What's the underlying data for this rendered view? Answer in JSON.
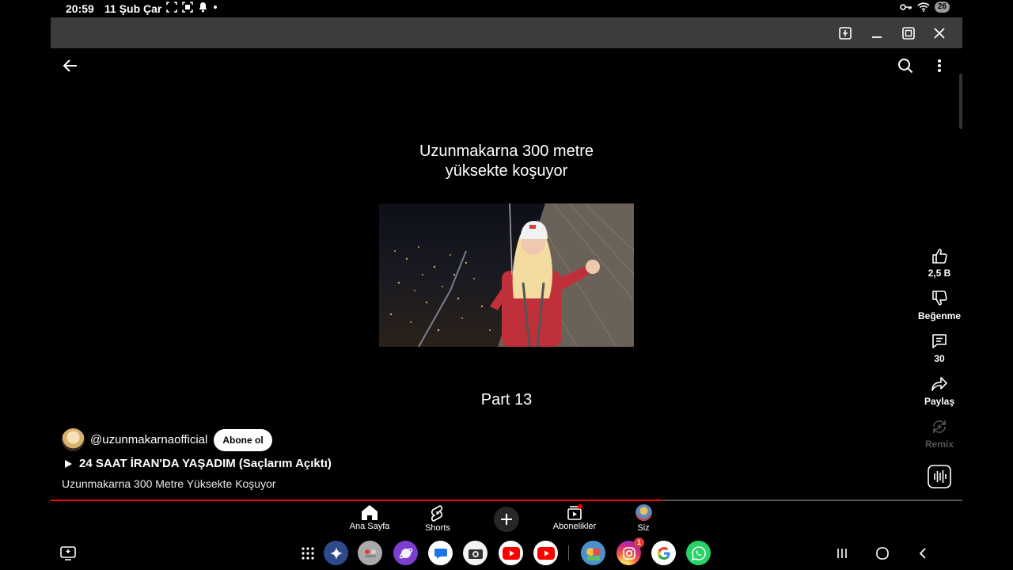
{
  "status_bar": {
    "time": "20:59",
    "date": "11 Şub Çar",
    "battery": "26"
  },
  "video": {
    "title_line1": "Uzunmakarna 300 metre",
    "title_line2": "yüksekte koşuyor",
    "part": "Part 13",
    "progress_fraction": 0.67
  },
  "actions": {
    "like_count": "2,5 B",
    "dislike_label": "Beğenme",
    "comment_count": "30",
    "share_label": "Paylaş",
    "remix_label": "Remix"
  },
  "channel": {
    "handle": "@uzunmakarnaofficial",
    "subscribe_label": "Abone ol"
  },
  "playlist_title": "24 SAAT İRAN'DA YAŞADIM (Saçlarım Açıktı)",
  "description": "Uzunmakarna 300 Metre Yüksekte Koşuyor",
  "bottom_nav": {
    "home": "Ana Sayfa",
    "shorts": "Shorts",
    "subscriptions": "Abonelikler",
    "you": "Siz"
  },
  "taskbar": {
    "instagram_badge": "1"
  },
  "colors": {
    "accent_red": "#ff0000",
    "window_bar": "#3c3c3c"
  }
}
